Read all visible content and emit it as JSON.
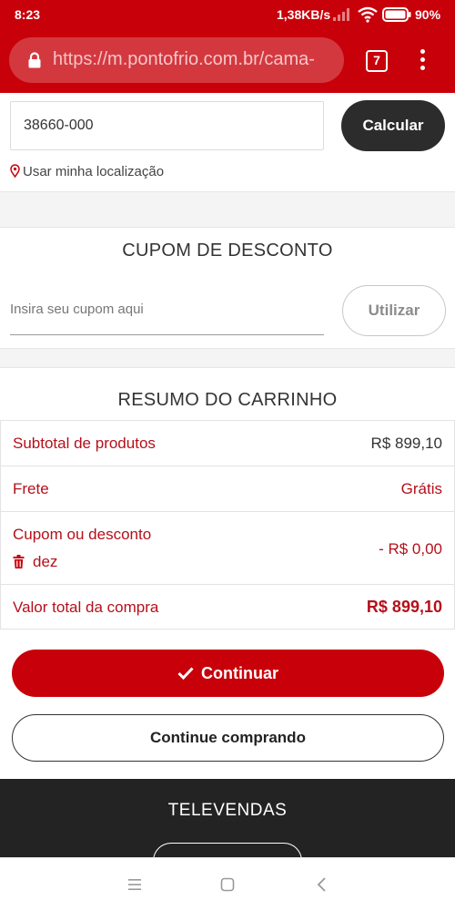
{
  "status_bar": {
    "time": "8:23",
    "network_speed": "1,38KB/s",
    "battery": "90%"
  },
  "browser": {
    "url_scheme": "https://",
    "url_rest": "m.pontofrio.com.br/cama-",
    "tab_count": "7"
  },
  "shipping": {
    "zip_value": "38660-000",
    "calculate_label": "Calcular",
    "use_location_label": "Usar minha localização"
  },
  "coupon": {
    "title": "CUPOM DE DESCONTO",
    "placeholder": "Insira seu cupom aqui",
    "apply_label": "Utilizar"
  },
  "summary": {
    "title": "RESUMO DO CARRINHO",
    "subtotal_label": "Subtotal de produtos",
    "subtotal_value": "R$ 899,10",
    "shipping_label": "Frete",
    "shipping_value": "Grátis",
    "coupon_label": "Cupom ou desconto",
    "coupon_code": "dez",
    "coupon_value": "- R$ 0,00",
    "total_label": "Valor total da compra",
    "total_value": "R$ 899,10"
  },
  "actions": {
    "continue_label": "Continuar",
    "keep_shopping_label": "Continue comprando"
  },
  "footer": {
    "televendas_label": "TELEVENDAS"
  },
  "colors": {
    "brand_red": "#c8000a",
    "dark": "#2c2c2c",
    "accent_text": "#b5101a"
  },
  "icons": [
    "lock-icon",
    "tabs-icon",
    "overflow-menu-icon",
    "location-pin-icon",
    "trash-icon",
    "check-icon",
    "recent-apps-icon",
    "home-icon",
    "back-icon"
  ]
}
